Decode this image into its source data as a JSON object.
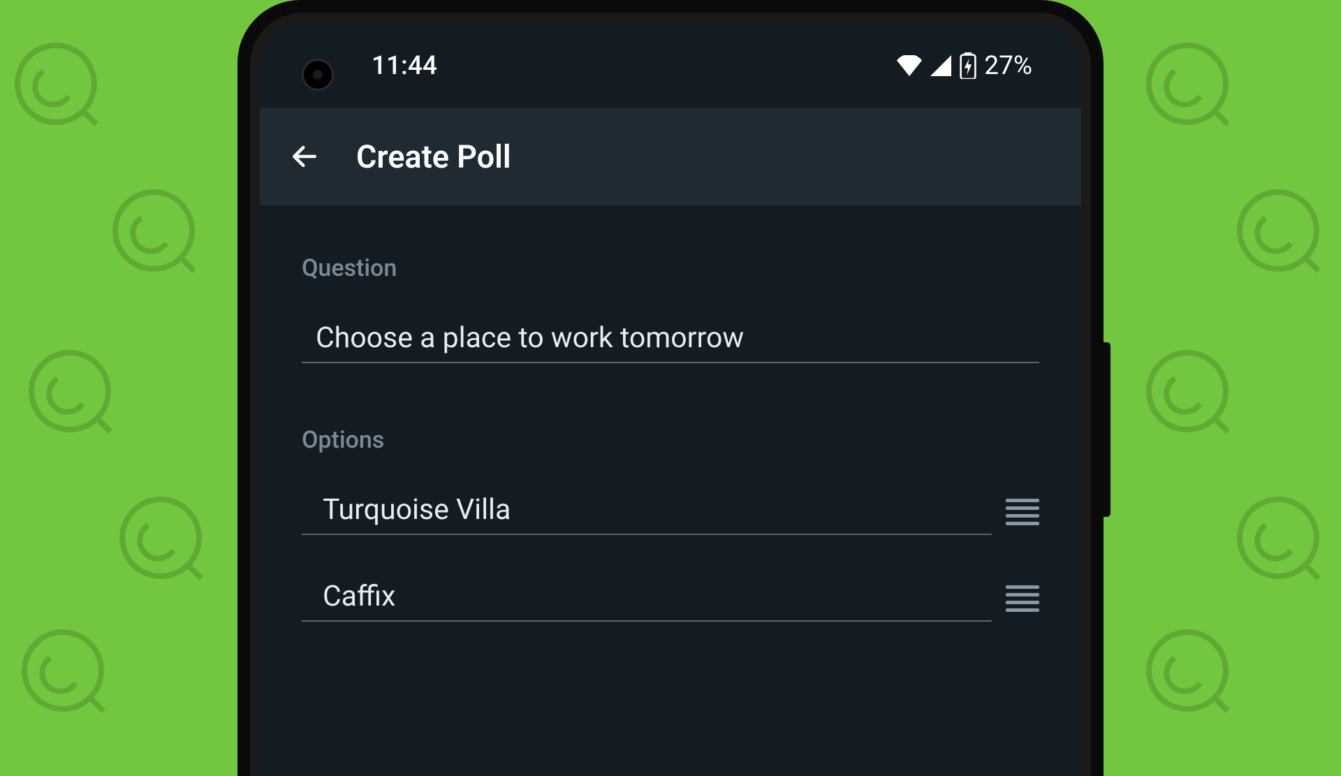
{
  "status": {
    "time": "11:44",
    "battery": "27%"
  },
  "appBar": {
    "title": "Create Poll"
  },
  "form": {
    "questionLabel": "Question",
    "questionValue": "Choose a place to work tomorrow",
    "optionsLabel": "Options",
    "options": [
      {
        "value": "Turquoise Villa"
      },
      {
        "value": "Caffix"
      }
    ]
  }
}
